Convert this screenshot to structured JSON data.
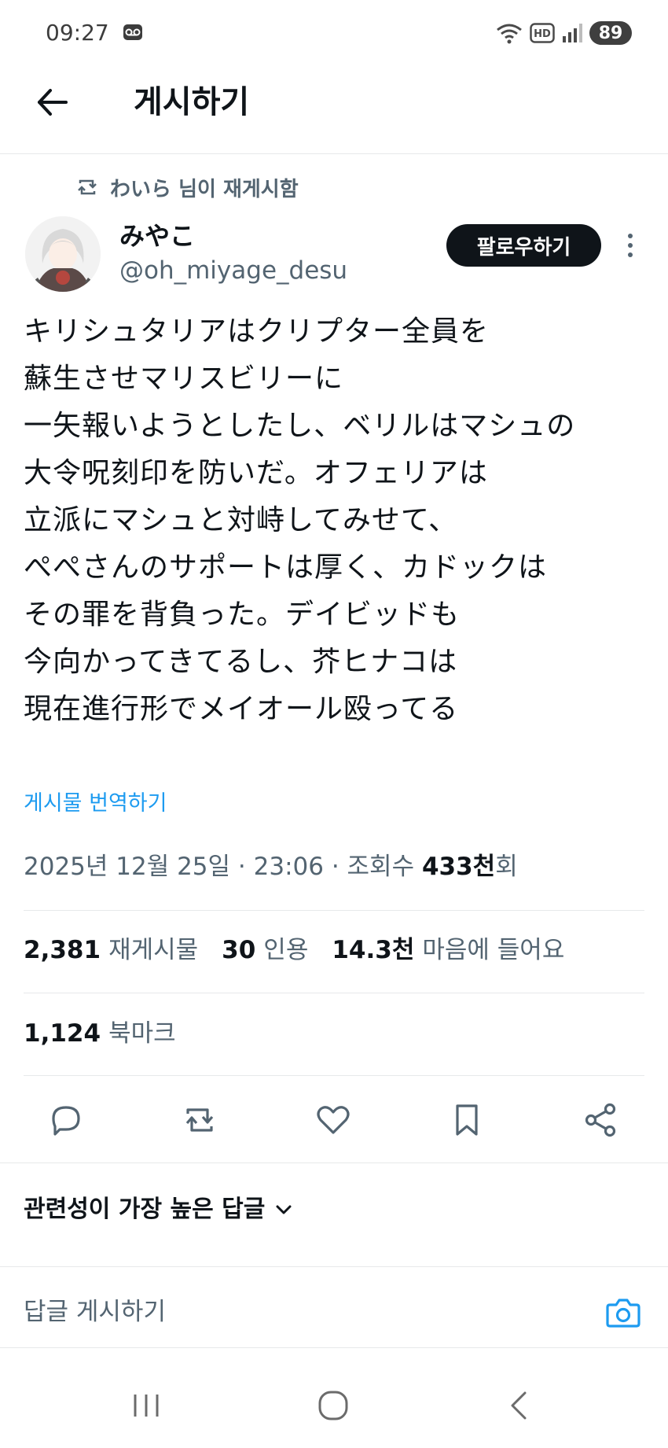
{
  "status_bar": {
    "time": "09:27",
    "battery": "89",
    "icons": [
      "voicemail-icon",
      "wifi-icon",
      "hd-icon",
      "signal-icon"
    ]
  },
  "header": {
    "back_icon": "arrow-left-icon",
    "title": "게시하기"
  },
  "repost": {
    "reposter": "わいら",
    "suffix": " 님이 재게시함"
  },
  "author": {
    "display_name": "みやこ",
    "handle": "@oh_miyage_desu",
    "follow_label": "팔로우하기"
  },
  "tweet": {
    "lines": [
      "キリシュタリアはクリプター全員を",
      "蘇生させマリスビリーに",
      "一矢報いようとしたし、ベリルはマシュの",
      "大令呪刻印を防いだ。オフェリアは",
      "立派にマシュと対峙してみせて、",
      "ぺぺさんのサポートは厚く、カドックは",
      "その罪を背負った。デイビッドも",
      "今向かってきてるし、芥ヒナコは",
      "現在進行形でメイオール殴ってる"
    ],
    "translate_label": "게시물 번역하기"
  },
  "meta": {
    "date": "2025년 12월 25일",
    "sep1": " · ",
    "time": "23:06",
    "sep2": " · ",
    "views_label": "조회수 ",
    "views_value": "433천",
    "views_suffix": "회"
  },
  "stats": {
    "reposts_value": "2,381",
    "reposts_label": "재게시물",
    "quotes_value": "30",
    "quotes_label": "인용",
    "likes_value": "14.3천",
    "likes_label": "마음에 들어요",
    "bookmarks_value": "1,124",
    "bookmarks_label": "북마크"
  },
  "actions": [
    "reply-icon",
    "repost-icon",
    "like-icon",
    "bookmark-icon",
    "share-icon"
  ],
  "replies": {
    "sort_label": "관련성이 가장 높은 답글",
    "placeholder": "답글 게시하기"
  },
  "colors": {
    "accent": "#1d9bf0",
    "text_primary": "#0f1419",
    "text_secondary": "#536471",
    "divider": "#e7e9ea"
  }
}
